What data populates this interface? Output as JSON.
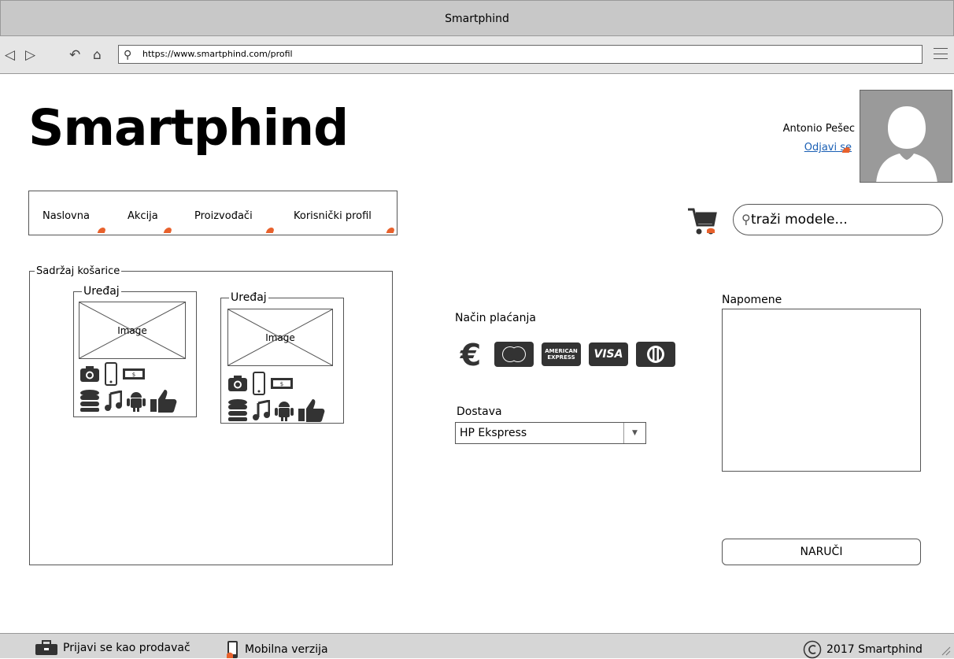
{
  "window": {
    "title": "Smartphind"
  },
  "browser": {
    "url": "https://www.smartphind.com/profil"
  },
  "header": {
    "logo": "Smartphind",
    "user_name": "Antonio Pešec",
    "logout": "Odjavi se"
  },
  "nav": {
    "items": [
      {
        "label": "Naslovna"
      },
      {
        "label": "Akcija"
      },
      {
        "label": "Proizvođači"
      },
      {
        "label": "Korisnički profil"
      }
    ]
  },
  "search": {
    "placeholder": "traži modele..."
  },
  "cart": {
    "title": "Sadržaj košarice",
    "devices": [
      {
        "title": "Uređaj",
        "image": "Image"
      },
      {
        "title": "Uređaj",
        "image": "Image"
      }
    ]
  },
  "payment": {
    "label": "Način plaćanja",
    "methods": [
      "euro-icon",
      "mastercard-icon",
      "amex-icon",
      "visa-icon",
      "diners-icon"
    ],
    "card_texts": {
      "amex": "AMERICAN EXPRESS",
      "visa": "VISA"
    }
  },
  "delivery": {
    "label": "Dostava",
    "selected": "HP Ekspress"
  },
  "notes": {
    "label": "Napomene"
  },
  "order": {
    "button": "NARUČI"
  },
  "footer": {
    "seller": "Prijavi se kao prodavač",
    "mobile": "Mobilna verzija",
    "copyright": "2017 Smartphind"
  },
  "colors": {
    "accent": "#e8612c",
    "link": "#1a5fb4"
  }
}
